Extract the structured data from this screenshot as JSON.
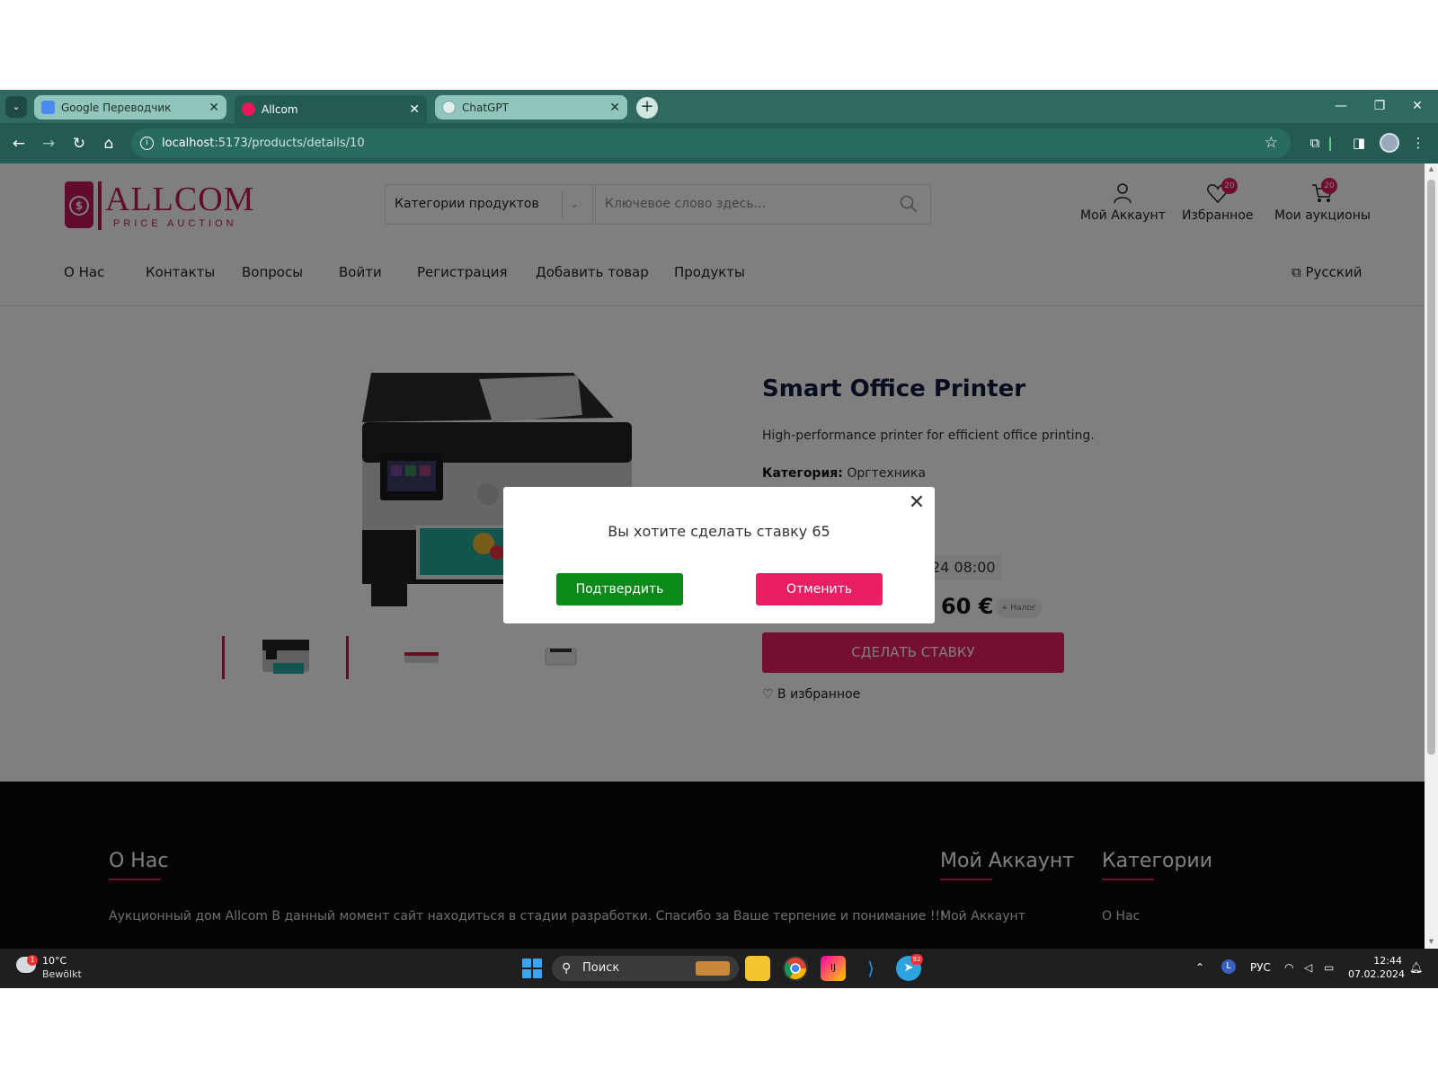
{
  "browser": {
    "tabs": [
      {
        "title": "Google Переводчик"
      },
      {
        "title": "Allcom"
      },
      {
        "title": "ChatGPT"
      }
    ],
    "url_host": "localhost",
    "url_path": ":5173/products/details/10"
  },
  "site": {
    "logo_title": "ALLCOM",
    "logo_subtitle": "PRICE AUCTION",
    "category_select": "Категории продуктов",
    "search_placeholder": "Ключевое слово здесь...",
    "header_icons": [
      {
        "label": "Мой Аккаунт",
        "icon": "user-icon"
      },
      {
        "label": "Избранное",
        "icon": "heart-icon",
        "badge": "20"
      },
      {
        "label": "Мои аукционы",
        "icon": "cart-icon",
        "badge": "20"
      }
    ],
    "nav": [
      "О Нас",
      "Контакты",
      "Вопросы",
      "Войти",
      "Регистрация",
      "Добавить товар",
      "Продукты"
    ],
    "language": "Русский"
  },
  "product": {
    "title": "Smart Office Printer",
    "description": "High-performance printer for efficient office printing.",
    "category_label": "Категория:",
    "category_value": "Оргтехника",
    "date_fragment": "24 08:00",
    "price": "60 €",
    "price_tag": "+ Налог",
    "bid_button": "СДЕЛАТЬ СТАВКУ",
    "favorite_link": "В избранное"
  },
  "modal": {
    "message": "Вы хотите сделать ставку 65",
    "confirm": "Подтвердить",
    "cancel": "Отменить"
  },
  "footer": {
    "about_title": "О Нас",
    "about_text": "Аукционный дом Allcom В данный момент сайт находиться в стадии разработки. Спасибо за Ваше терпение и понимание !!!",
    "account_title": "Мой Аккаунт",
    "account_link": "Мой Аккаунт",
    "categories_title": "Категории",
    "categories_link": "О Нас"
  },
  "taskbar": {
    "weather_badge": "1",
    "temperature": "10°C",
    "weather": "Bewölkt",
    "search": "Поиск",
    "telegram_badge": "92",
    "lang": "РУС",
    "time": "12:44",
    "date": "07.02.2024"
  },
  "colors": {
    "brand": "#c2185b",
    "accent": "#e91e63",
    "confirm": "#0b8a1a",
    "chrome": "#235a51"
  }
}
